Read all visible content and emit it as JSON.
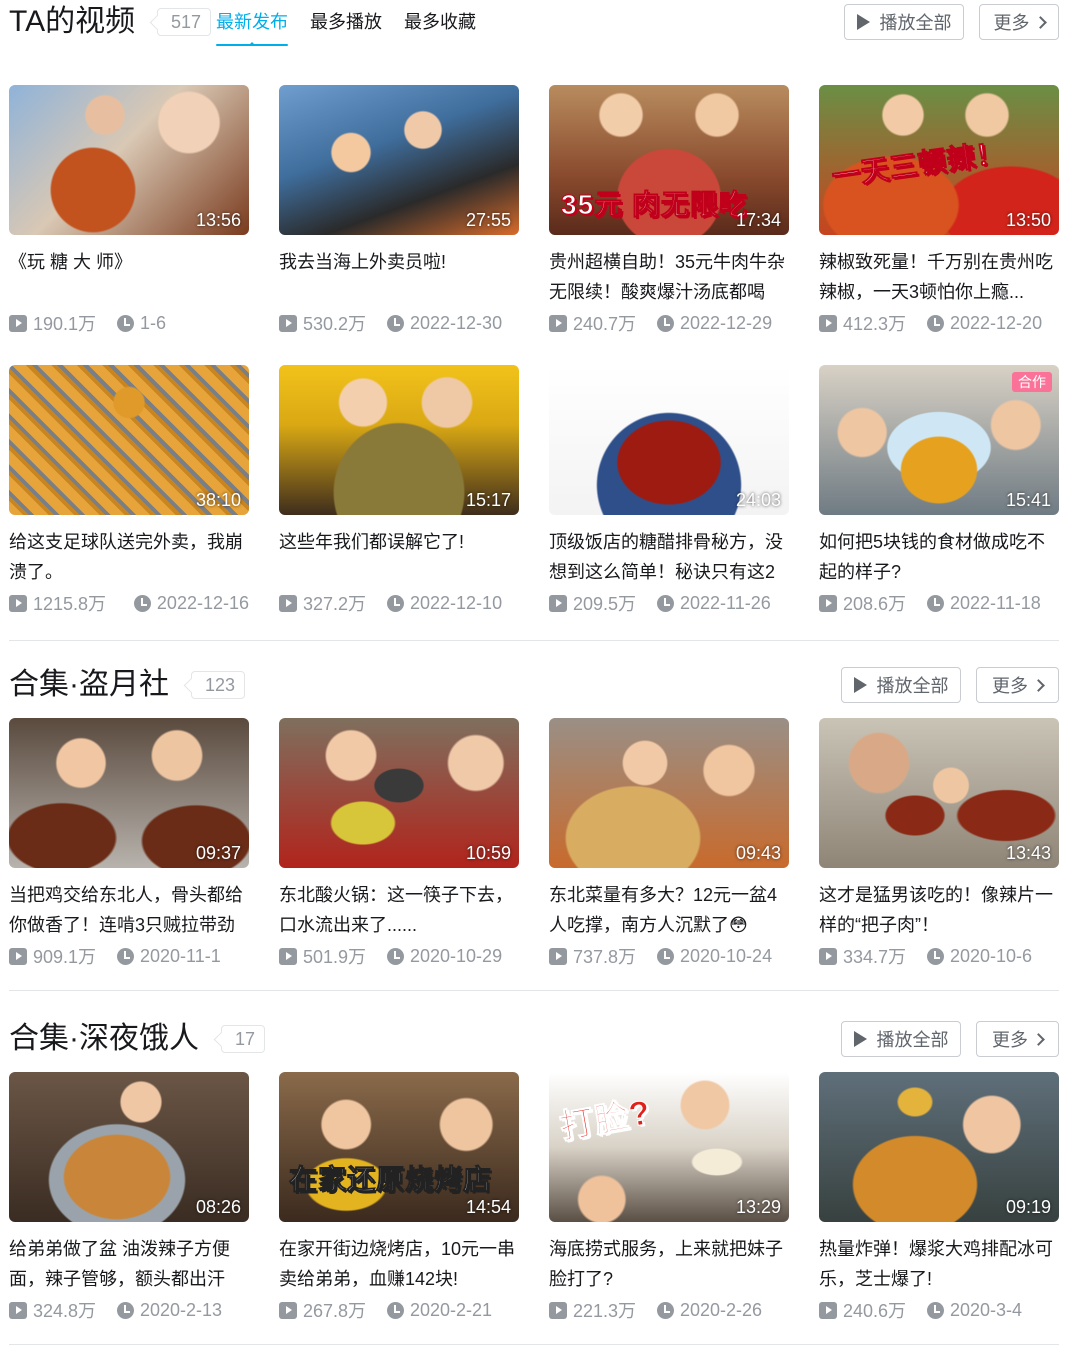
{
  "colors": {
    "accent": "#00aeec",
    "muted": "#9499a0",
    "border": "#e3e5e7",
    "collab": "#fb7299"
  },
  "videos_section": {
    "title": "TA的视频",
    "count": "517",
    "tabs": [
      {
        "label": "最新发布",
        "active": true
      },
      {
        "label": "最多播放",
        "active": false
      },
      {
        "label": "最多收藏",
        "active": false
      }
    ],
    "play_all": "播放全部",
    "more": "更多",
    "items": [
      {
        "title": "《玩 糖 大 师》",
        "duration": "13:56",
        "plays": "190.1万",
        "date": "1-6"
      },
      {
        "title": "我去当海上外卖员啦!",
        "duration": "27:55",
        "plays": "530.2万",
        "date": "2022-12-30"
      },
      {
        "title": "贵州超横自助！35元牛肉牛杂无限续！酸爽爆汁汤底都喝",
        "duration": "17:34",
        "plays": "240.7万",
        "date": "2022-12-29",
        "caption": "35元 肉无限吃"
      },
      {
        "title": "辣椒致死量！千万别在贵州吃辣椒，一天3顿怕你上瘾...",
        "duration": "13:50",
        "plays": "412.3万",
        "date": "2022-12-20",
        "caption": "一天三顿辣！"
      },
      {
        "title": "给这支足球队送完外卖，我崩溃了。",
        "duration": "38:10",
        "plays": "1215.8万",
        "date": "2022-12-16"
      },
      {
        "title": "这些年我们都误解它了!",
        "duration": "15:17",
        "plays": "327.2万",
        "date": "2022-12-10"
      },
      {
        "title": "顶级饭店的糖醋排骨秘方，没想到这么简单！秘诀只有这2",
        "duration": "24:03",
        "plays": "209.5万",
        "date": "2022-11-26"
      },
      {
        "title": "如何把5块钱的食材做成吃不起的样子?",
        "duration": "15:41",
        "plays": "208.6万",
        "date": "2022-11-18",
        "badge": "合作"
      }
    ]
  },
  "collection_1": {
    "title": "合集·盗月社",
    "count": "123",
    "play_all": "播放全部",
    "more": "更多",
    "items": [
      {
        "title": "当把鸡交给东北人，骨头都给你做香了！连啃3只贼拉带劲",
        "duration": "09:37",
        "plays": "909.1万",
        "date": "2020-11-1"
      },
      {
        "title": "东北酸火锅：这一筷子下去，口水流出来了......",
        "duration": "10:59",
        "plays": "501.9万",
        "date": "2020-10-29"
      },
      {
        "title": "东北菜量有多大？12元一盆4人吃撑，南方人沉默了😳",
        "duration": "09:43",
        "plays": "737.8万",
        "date": "2020-10-24"
      },
      {
        "title": "这才是猛男该吃的！像辣片一样的“把子肉”！",
        "duration": "13:43",
        "plays": "334.7万",
        "date": "2020-10-6"
      }
    ]
  },
  "collection_2": {
    "title": "合集·深夜饿人",
    "count": "17",
    "play_all": "播放全部",
    "more": "更多",
    "items": [
      {
        "title": "给弟弟做了盆 油泼辣子方便面，辣子管够，额头都出汗",
        "duration": "08:26",
        "plays": "324.8万",
        "date": "2020-2-13"
      },
      {
        "title": "在家开街边烧烤店，10元一串卖给弟弟，血赚142块!",
        "duration": "14:54",
        "plays": "267.8万",
        "date": "2020-2-21",
        "caption": "在家还原烧烤店"
      },
      {
        "title": "海底捞式服务，上来就把妹子脸打了?",
        "duration": "13:29",
        "plays": "221.3万",
        "date": "2020-2-26",
        "caption": "打脸?"
      },
      {
        "title": "热量炸弹！爆浆大鸡排配冰可乐，芝士爆了!",
        "duration": "09:19",
        "plays": "240.6万",
        "date": "2020-3-4"
      }
    ]
  }
}
